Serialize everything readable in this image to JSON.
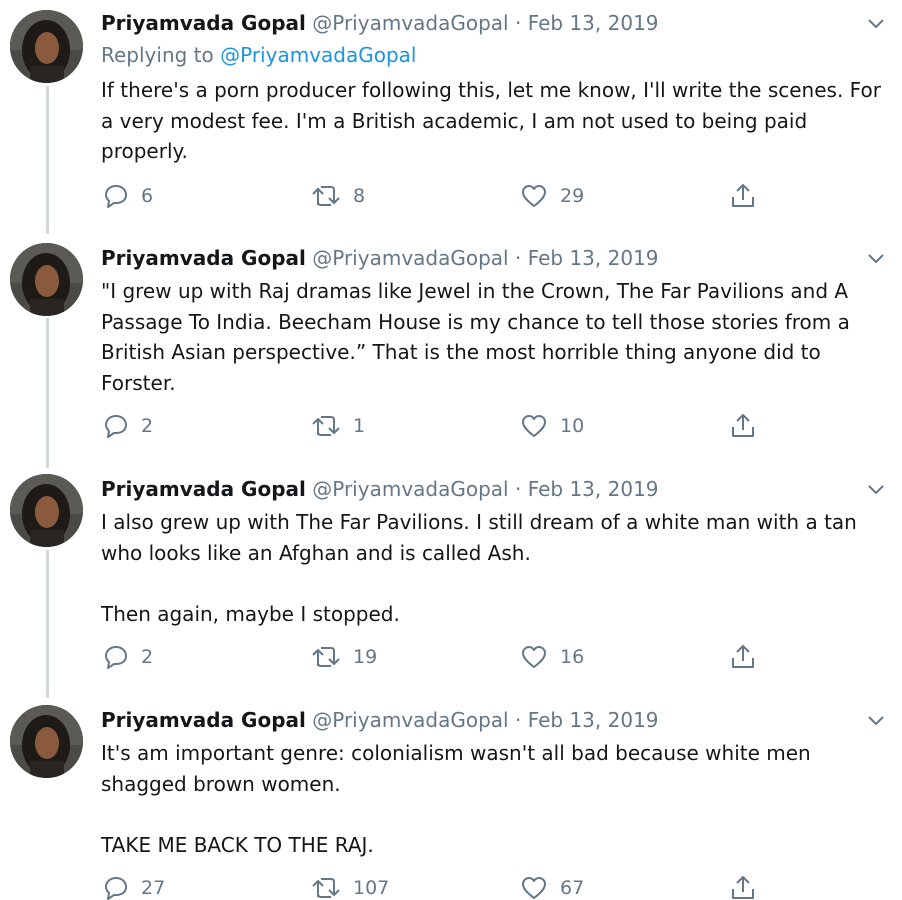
{
  "tweets": [
    {
      "author": {
        "name": "Priyamvada Gopal",
        "handle": "@PriyamvadaGopal"
      },
      "separator": "·",
      "date": "Feb 13, 2019",
      "replying_to_label": "Replying to",
      "replying_to_handle": "@PriyamvadaGopal",
      "text": "If there's a porn producer following this, let me know, I'll write the scenes. For a very modest fee. I'm a British academic, I am not used to being paid properly.",
      "replies": "6",
      "retweets": "8",
      "likes": "29"
    },
    {
      "author": {
        "name": "Priyamvada Gopal",
        "handle": "@PriyamvadaGopal"
      },
      "separator": "·",
      "date": "Feb 13, 2019",
      "text": "\"I grew up with Raj dramas like Jewel in the Crown, The Far Pavilions and A Passage To India. Beecham House is my chance to tell those stories from a British Asian perspective.” That is the most horrible thing anyone did to Forster.",
      "replies": "2",
      "retweets": "1",
      "likes": "10"
    },
    {
      "author": {
        "name": "Priyamvada Gopal",
        "handle": "@PriyamvadaGopal"
      },
      "separator": "·",
      "date": "Feb 13, 2019",
      "text": "I also grew up with The Far Pavilions. I still dream of a white man with a tan who looks like an Afghan and is called Ash.\n\nThen again, maybe I stopped.",
      "replies": "2",
      "retweets": "19",
      "likes": "16"
    },
    {
      "author": {
        "name": "Priyamvada Gopal",
        "handle": "@PriyamvadaGopal"
      },
      "separator": "·",
      "date": "Feb 13, 2019",
      "text": "It's am important genre: colonialism wasn't all bad because white men shagged brown women.\n\nTAKE ME BACK TO THE RAJ.",
      "replies": "27",
      "retweets": "107",
      "likes": "67"
    }
  ],
  "icons": {
    "reply": "reply-icon",
    "retweet": "retweet-icon",
    "like": "heart-icon",
    "share": "share-icon",
    "caret": "chevron-down-icon"
  },
  "colors": {
    "text": "#14171a",
    "secondary": "#657786",
    "link": "#1b95e0",
    "thread_line": "#d0d7de"
  }
}
